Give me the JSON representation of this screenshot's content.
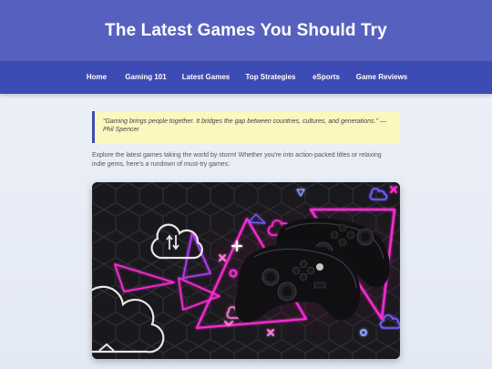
{
  "header": {
    "title": "The Latest Games You Should Try"
  },
  "nav": {
    "items": [
      {
        "label": "Home"
      },
      {
        "label": "Gaming 101"
      },
      {
        "label": "Latest Games"
      },
      {
        "label": "Top Strategies"
      },
      {
        "label": "eSports"
      },
      {
        "label": "Game Reviews"
      }
    ]
  },
  "quote": {
    "text": "\"Gaming brings people together. It bridges the gap between countries, cultures, and generations.\" — Phil Spencer"
  },
  "intro": {
    "text": "Explore the latest games taking the world by storm! Whether you're into action-packed titles or relaxing indie gems, here's a rundown of must-try games:"
  },
  "hero_image": {
    "subject": "two black game controllers on a dark hexagon background with neon pink triangle and cloud icons",
    "accent_colors": [
      "#ff2bd6",
      "#7a5cff",
      "#ffffff"
    ]
  }
}
